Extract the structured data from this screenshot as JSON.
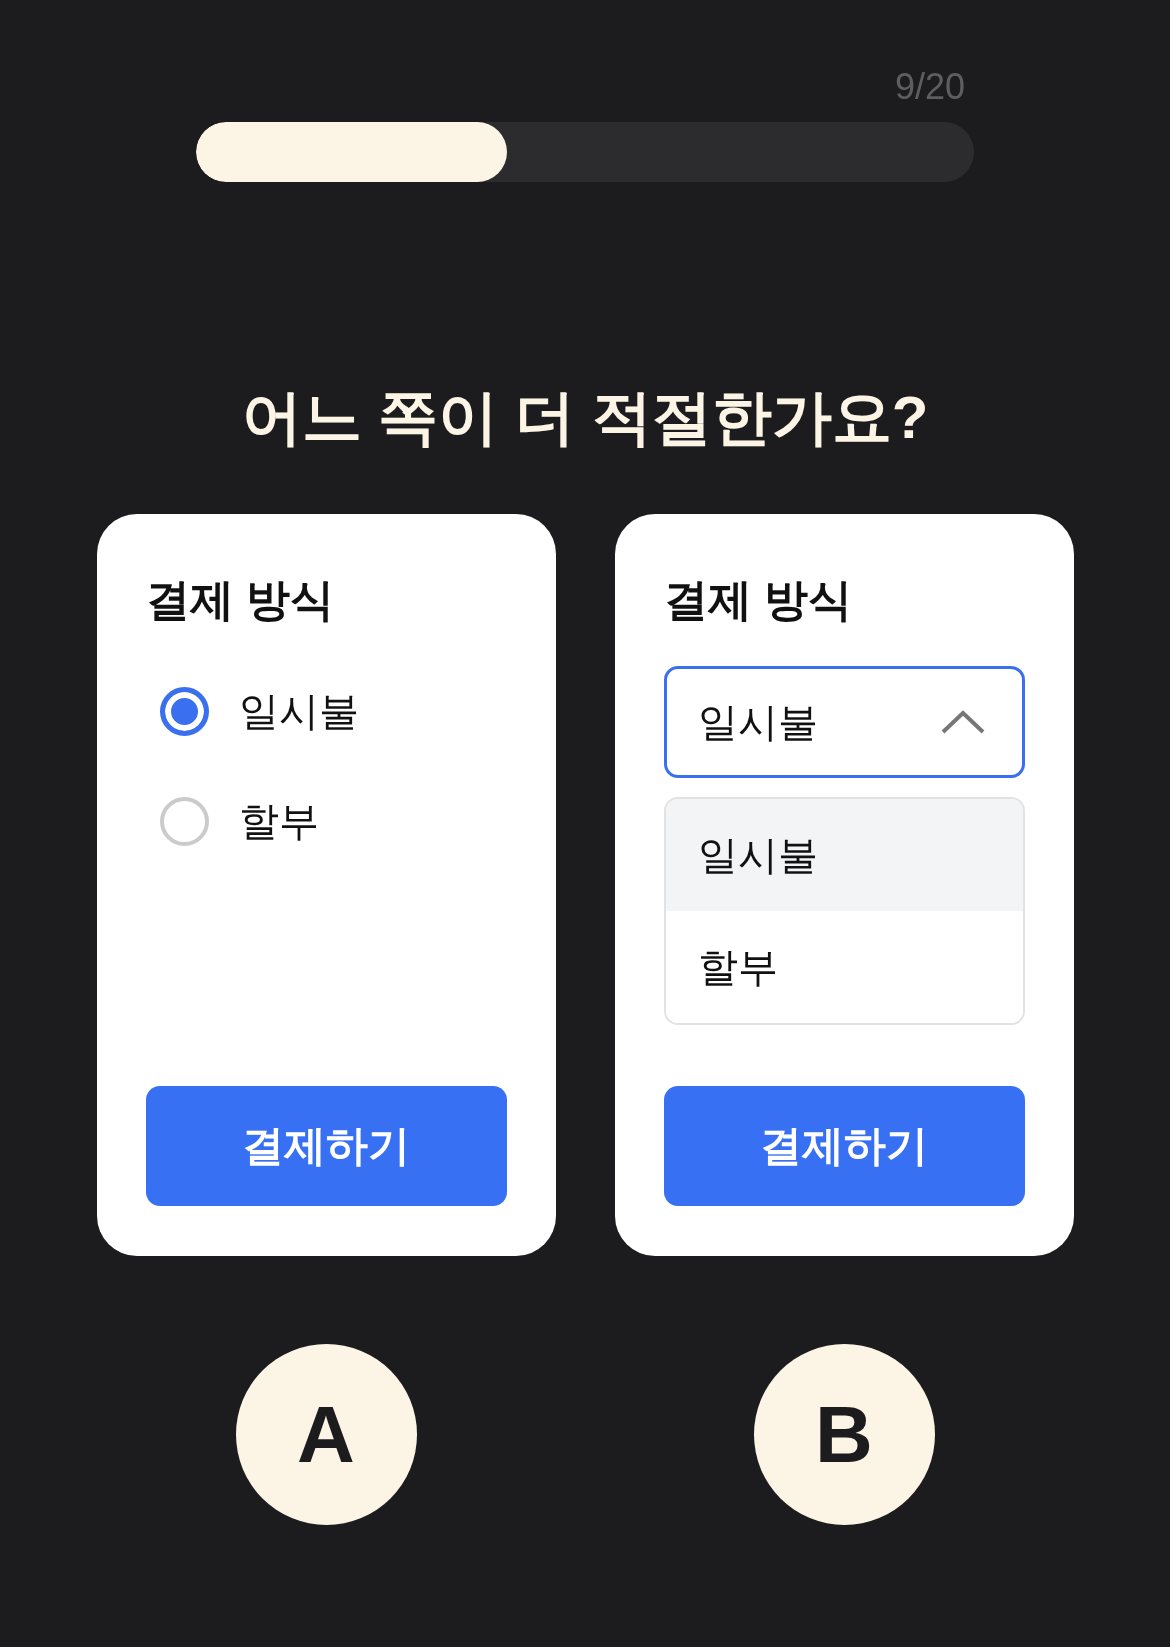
{
  "progress": {
    "counter": "9/20",
    "level": 0.4
  },
  "question": "어느 쪽이 더 적절한가요?",
  "options": [
    {
      "kind": "radio",
      "title": "결제 방식",
      "choices": [
        {
          "label": "일시불",
          "selected": true
        },
        {
          "label": "할부",
          "selected": false
        }
      ],
      "button": "결제하기"
    },
    {
      "kind": "dropdown",
      "title": "결제 방식",
      "value": "일시불",
      "expanded": true,
      "choices": [
        {
          "label": "일시불",
          "selected": true
        },
        {
          "label": "할부",
          "selected": false
        }
      ],
      "button": "결제하기"
    }
  ],
  "answers": [
    {
      "label": "A",
      "selected": false
    },
    {
      "label": "B",
      "selected": false
    }
  ]
}
